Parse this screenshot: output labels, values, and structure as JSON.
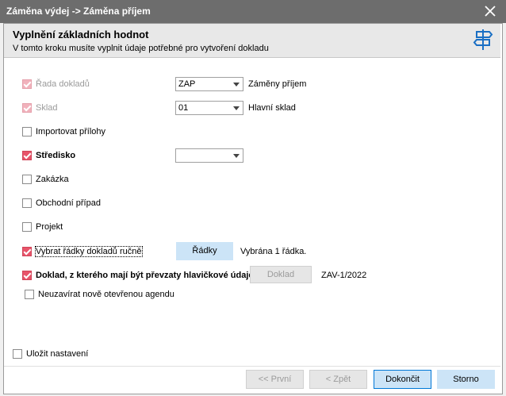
{
  "window": {
    "title": "Záměna výdej -> Záměna příjem"
  },
  "header": {
    "title": "Vyplnění základních hodnot",
    "subtitle": "V tomto kroku musíte vyplnit údaje potřebné pro vytvoření dokladu"
  },
  "fields": {
    "rada": {
      "label": "Řada dokladů",
      "value": "ZAP",
      "description": "Záměny příjem"
    },
    "sklad": {
      "label": "Sklad",
      "value": "01",
      "description": "Hlavní sklad"
    },
    "importovat": {
      "label": "Importovat přílohy"
    },
    "stredisko": {
      "label": "Středisko",
      "value": ""
    },
    "zakazka": {
      "label": "Zakázka"
    },
    "obchodni_pripad": {
      "label": "Obchodní případ"
    },
    "projekt": {
      "label": "Projekt"
    },
    "vybrat_radky": {
      "label": "Vybrat řádky dokladů ručně",
      "button": "Řádky",
      "status": "Vybrána 1 řádka."
    },
    "doklad": {
      "label": "Doklad, z kterého mají být převzaty hlavičkové údaje",
      "button": "Doklad",
      "value": "ZAV-1/2022"
    },
    "neuzavirat": {
      "label": "Neuzavírat nově otevřenou agendu"
    }
  },
  "footer": {
    "ulozit": "Uložit nastavení",
    "prvni": "<< První",
    "zpet": "< Zpět",
    "dokoncit": "Dokončit",
    "storno": "Storno"
  },
  "colors": {
    "checkbox_accent": "#e8546a",
    "titlebar": "#6d6d6d",
    "button_primary_border": "#0078d7"
  }
}
